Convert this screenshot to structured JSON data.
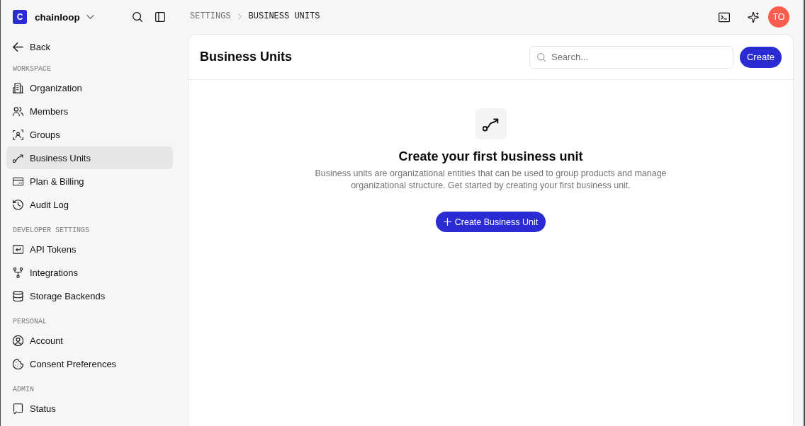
{
  "workspace": {
    "initial": "C",
    "name": "chainloop"
  },
  "sidebar": {
    "back": "Back",
    "sections": [
      {
        "title": "WORKSPACE",
        "items": [
          {
            "label": "Organization",
            "selected": false
          },
          {
            "label": "Members",
            "selected": false
          },
          {
            "label": "Groups",
            "selected": false
          },
          {
            "label": "Business Units",
            "selected": true
          },
          {
            "label": "Plan & Billing",
            "selected": false
          },
          {
            "label": "Audit Log",
            "selected": false
          }
        ]
      },
      {
        "title": "DEVELOPER SETTINGS",
        "items": [
          {
            "label": "API Tokens",
            "selected": false
          },
          {
            "label": "Integrations",
            "selected": false
          },
          {
            "label": "Storage Backends",
            "selected": false
          }
        ]
      },
      {
        "title": "PERSONAL",
        "items": [
          {
            "label": "Account",
            "selected": false
          },
          {
            "label": "Consent Preferences",
            "selected": false
          }
        ]
      },
      {
        "title": "ADMIN",
        "items": [
          {
            "label": "Status",
            "selected": false
          }
        ]
      }
    ]
  },
  "breadcrumb": [
    "SETTINGS",
    "BUSINESS UNITS"
  ],
  "user": {
    "initials": "TO"
  },
  "page": {
    "title": "Business Units",
    "search": {
      "placeholder": "Search..."
    },
    "create_button": "Create"
  },
  "empty_state": {
    "title": "Create your first business unit",
    "description": "Business units are organizational entities that can be used to group products and manage organizational structure. Get started by creating your first business unit.",
    "button": "Create Business Unit"
  }
}
